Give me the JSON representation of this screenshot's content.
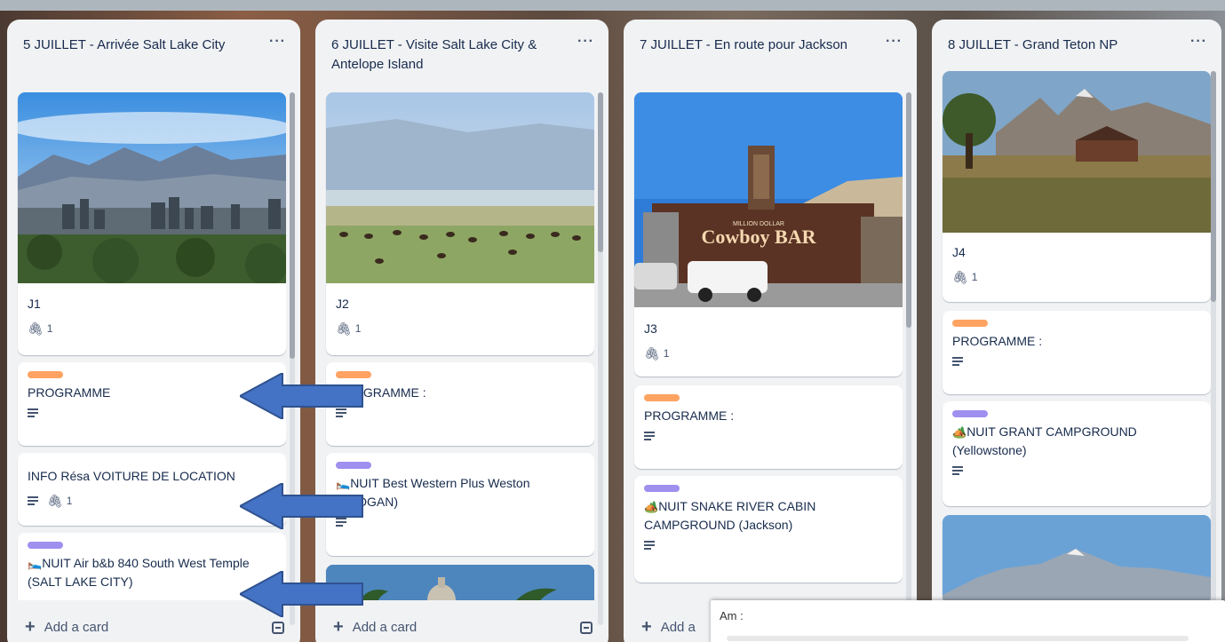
{
  "lists": [
    {
      "title": "5 JUILLET - Arrivée Salt Lake City",
      "cards": [
        {
          "title": "J1",
          "attachments": "1"
        },
        {
          "title": "PROGRAMME"
        },
        {
          "title": "INFO Résa VOITURE DE LOCATION",
          "attachments": "1"
        },
        {
          "emoji": "🛌",
          "title": "NUIT Air b&b 840 South West Temple (SALT LAKE CITY)"
        }
      ],
      "add_card": "Add a card"
    },
    {
      "title": "6 JUILLET - Visite Salt Lake City & Antelope Island",
      "cards": [
        {
          "title": "J2",
          "attachments": "1"
        },
        {
          "title": "OGRAMME :"
        },
        {
          "emoji": "🛌",
          "title": "NUIT Best Western Plus Weston",
          "title_2": "n (LOGAN)"
        }
      ],
      "add_card": "Add a card"
    },
    {
      "title": "7 JUILLET - En route pour Jackson",
      "cards": [
        {
          "title": "J3",
          "attachments": "1",
          "sign_top": "MILLION DOLLAR",
          "sign_main": "Cowboy BAR"
        },
        {
          "title": "PROGRAMME :"
        },
        {
          "emoji": "🏕️",
          "title": "NUIT SNAKE RIVER CABIN CAMPGROUND (Jackson)"
        }
      ],
      "add_card": "Add a"
    },
    {
      "title": "8 JUILLET - Grand Teton NP",
      "cards": [
        {
          "title": "J4",
          "attachments": "1"
        },
        {
          "title": "PROGRAMME :"
        },
        {
          "emoji": "🏕️",
          "title": "NUIT GRANT CAMPGROUND (Yellowstone)"
        }
      ]
    }
  ],
  "menu_glyph": "···",
  "popup": {
    "text": "Am :"
  },
  "colors": {
    "orange_label": "#fea362",
    "purple_label": "#9f8fef",
    "arrow": "#4472c4"
  }
}
